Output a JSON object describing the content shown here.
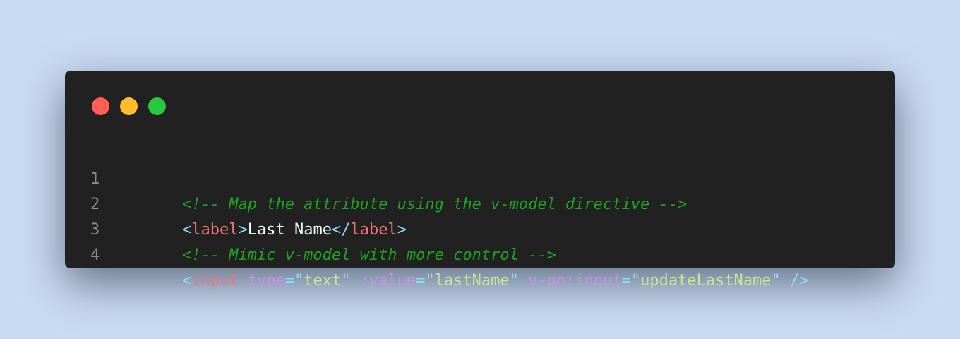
{
  "window": {
    "controls": [
      {
        "name": "close",
        "color": "#ff5f56"
      },
      {
        "name": "minimize",
        "color": "#ffbd2e"
      },
      {
        "name": "maximize",
        "color": "#27c93f"
      }
    ]
  },
  "code": {
    "lines": [
      {
        "number": "1",
        "comment": "<!-- Map the attribute using the v-model directive -->"
      },
      {
        "number": "2",
        "open_lt": "<",
        "open_tag": "label",
        "open_gt": ">",
        "text": "Last Name",
        "close_lt": "</",
        "close_tag": "label",
        "close_gt": ">"
      },
      {
        "number": "3",
        "comment": "<!-- Mimic v-model with more control -->"
      },
      {
        "number": "4",
        "lt": "<",
        "tag": "input",
        "attr1_name": "type",
        "attr1_value": "text",
        "attr2_name": ":value",
        "attr2_value": "lastName",
        "attr3_name": "v-on:input",
        "attr3_value": "updateLastName",
        "self_close": "/>"
      }
    ],
    "eq": "=",
    "quote": "\""
  }
}
